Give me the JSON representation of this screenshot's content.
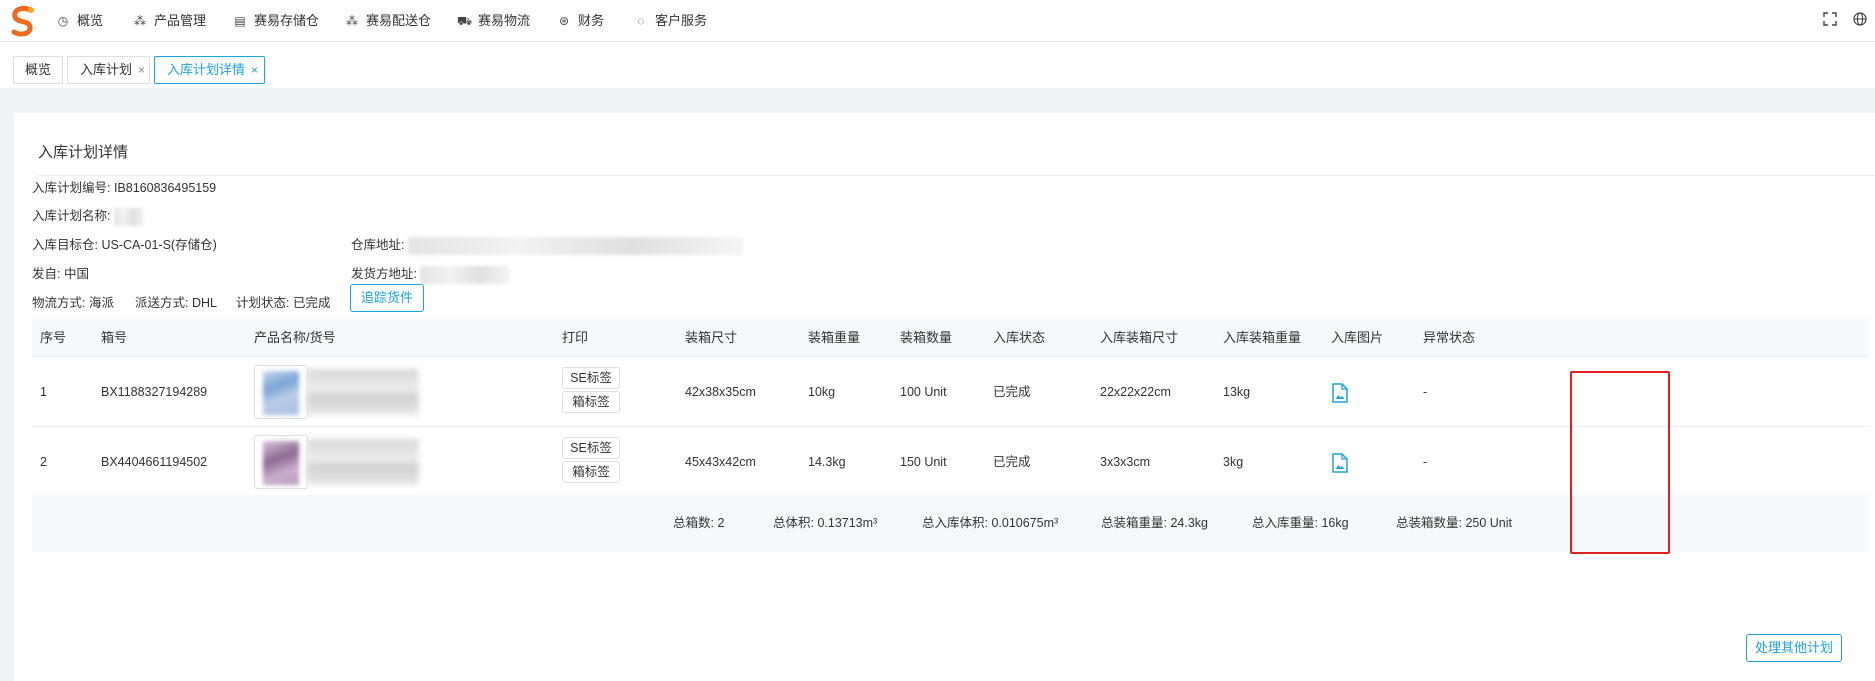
{
  "nav": {
    "items": [
      {
        "label": "概览",
        "icon": "dashboard-icon"
      },
      {
        "label": "产品管理",
        "icon": "product-icon"
      },
      {
        "label": "赛易存储仓",
        "icon": "storage-icon"
      },
      {
        "label": "赛易配送仓",
        "icon": "distribution-icon"
      },
      {
        "label": "赛易物流",
        "icon": "truck-icon"
      },
      {
        "label": "财务",
        "icon": "finance-icon"
      },
      {
        "label": "客户服务",
        "icon": "chat-icon"
      }
    ]
  },
  "tabs": [
    {
      "label": "概览"
    },
    {
      "label": "入库计划"
    },
    {
      "label": "入库计划详情"
    }
  ],
  "page": {
    "title": "入库计划详情"
  },
  "info": {
    "plan_no": "入库计划编号: IB8160836495159",
    "plan_name": "入库计划名称:",
    "target_wh": "入库目标仓: US-CA-01-S(存储仓)",
    "wh_addr": "仓库地址:",
    "ship_from": "发自: 中国",
    "sender_addr": "发货方地址:",
    "logistics": "物流方式: 海派",
    "delivery": "派送方式: DHL",
    "status": "计划状态: 已完成",
    "track_btn": "追踪货件"
  },
  "table": {
    "headers": [
      "序号",
      "箱号",
      "产品名称/货号",
      "打印",
      "装箱尺寸",
      "装箱重量",
      "装箱数量",
      "入库状态",
      "入库装箱尺寸",
      "入库装箱重量",
      "入库图片",
      "异常状态"
    ],
    "rows": [
      {
        "no": "1",
        "box": "BX1188327194289",
        "print1": "SE标签",
        "print2": "箱标签",
        "size": "42x38x35cm",
        "weight": "10kg",
        "qty": "100 Unit",
        "status": "已完成",
        "in_size": "22x22x22cm",
        "in_weight": "13kg",
        "exception": "-"
      },
      {
        "no": "2",
        "box": "BX4404661194502",
        "print1": "SE标签",
        "print2": "箱标签",
        "size": "45x43x42cm",
        "weight": "14.3kg",
        "qty": "150 Unit",
        "status": "已完成",
        "in_size": "3x3x3cm",
        "in_weight": "3kg",
        "exception": "-"
      }
    ]
  },
  "summary": {
    "boxes": "总箱数: 2",
    "volume": "总体积: 0.13713m³",
    "in_volume": "总入库体积: 0.010675m³",
    "pack_weight": "总装箱重量: 24.3kg",
    "in_weight": "总入库重量: 16kg",
    "pack_qty": "总装箱数量: 250 Unit"
  },
  "footer": {
    "process_btn": "处理其他计划"
  },
  "colors": {
    "accent": "#1ca4e0",
    "highlight": "#e02020"
  }
}
